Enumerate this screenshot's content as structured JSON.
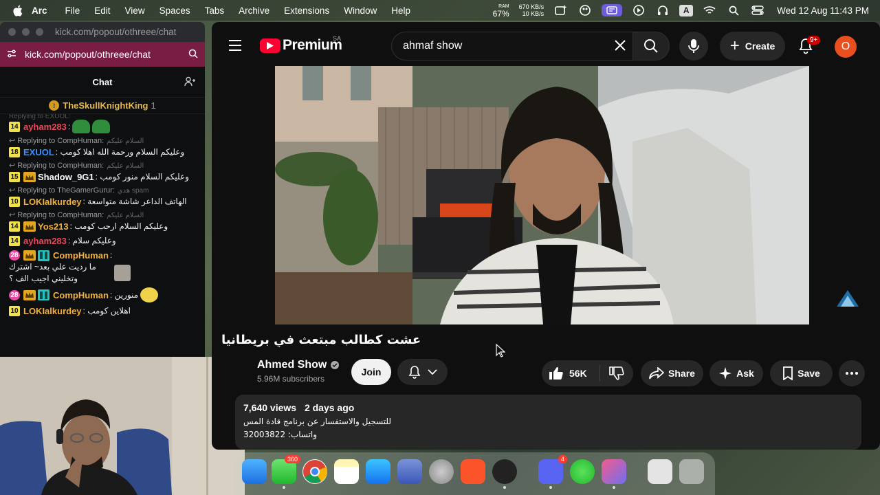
{
  "menubar": {
    "app_name": "Arc",
    "items": [
      "File",
      "Edit",
      "View",
      "Spaces",
      "Tabs",
      "Archive",
      "Extensions",
      "Window",
      "Help"
    ],
    "ram_label": "RAM",
    "ram_value": "67%",
    "net_up": "670 KB/s",
    "net_down": "10 KB/s",
    "keyboard_label": "A",
    "datetime": "Wed 12 Aug  11:43 PM"
  },
  "chat_window": {
    "title_url": "kick.com/popout/othreee/chat",
    "url": "kick.com/popout/othreee/chat",
    "header": "Chat",
    "pinned_user": "TheSkullKnightKing",
    "pinned_count": "1",
    "faded_reply": "Replying to EXUOL:",
    "messages": [
      {
        "badge": "14",
        "user": "ayham283",
        "color": "#e8485a",
        "text": "",
        "emote": "frog",
        "reply": "",
        "reply_ar": ""
      },
      {
        "badge": "18",
        "user": "EXUOL",
        "color": "#3b8fff",
        "text": "وعليكم السلام ورحمة الله اهلا كومب",
        "emote": "",
        "reply": "Replying to CompHuman:",
        "reply_ar": "السلام عليكم"
      },
      {
        "badge": "15",
        "user": "Shadow_9G1",
        "color": "#ffffff",
        "crown": true,
        "text": "وعليكم السلام منور كومب",
        "emote": "",
        "reply": "Replying to CompHuman:",
        "reply_ar": "السلام عليكم"
      },
      {
        "badge": "10",
        "user": "LOKIalkurdey",
        "color": "#f4b03c",
        "text": "الهاتف الداعر شاشة متواسعة",
        "emote": "",
        "reply": "Replying to TheGamerGurur:",
        "reply_ar": "هدي spam"
      },
      {
        "badge": "14",
        "user": "Yos213",
        "color": "#f4b03c",
        "crown": true,
        "text": "وعليكم السلام ارحب كومب",
        "emote": "",
        "reply": "Replying to CompHuman:",
        "reply_ar": "السلام عليكم"
      },
      {
        "badge": "14",
        "user": "ayham283",
        "color": "#e8485a",
        "text": "وعليكم سلام",
        "emote": "",
        "reply": "",
        "reply_ar": ""
      },
      {
        "badge": "28",
        "pink": true,
        "crown": true,
        "sub": true,
        "user": "CompHuman",
        "color": "#f4b03c",
        "text": "ما رديت علي بعد~ اشترك وتخليني اجيب الف ؟",
        "emote": "photo",
        "reply": "",
        "reply_ar": ""
      },
      {
        "badge": "28",
        "pink": true,
        "crown": true,
        "sub": true,
        "user": "CompHuman",
        "color": "#f4b03c",
        "text": "منورين",
        "emote": "face",
        "reply": "",
        "reply_ar": ""
      },
      {
        "badge": "10",
        "user": "LOKIalkurdey",
        "color": "#f4b03c",
        "text": "اهلاين كومب",
        "emote": "",
        "reply": "",
        "reply_ar": ""
      }
    ]
  },
  "youtube": {
    "logo_text": "Premium",
    "country": "SA",
    "search_value": "ahmaf show",
    "create_label": "Create",
    "notification_count": "9+",
    "avatar_letter": "O",
    "video_title": "عشت كطالب مبتعث في بريطانيا",
    "channel_name": "Ahmed Show",
    "subscribers": "5.96M subscribers",
    "join_label": "Join",
    "like_count": "56K",
    "share_label": "Share",
    "ask_label": "Ask",
    "save_label": "Save",
    "views": "7,640 views",
    "uploaded": "2 days ago",
    "desc_line1": "للتسجيل والاستفسار عن برنامج قادة المس",
    "desc_line2": "واتساب: 32003822"
  },
  "dock": {
    "messages_badge": "360",
    "discord_badge": "4"
  },
  "colors": {
    "kick_urlbar": "#7a1d44",
    "yt_red": "#ff0033",
    "avatar": "#e8501f"
  }
}
